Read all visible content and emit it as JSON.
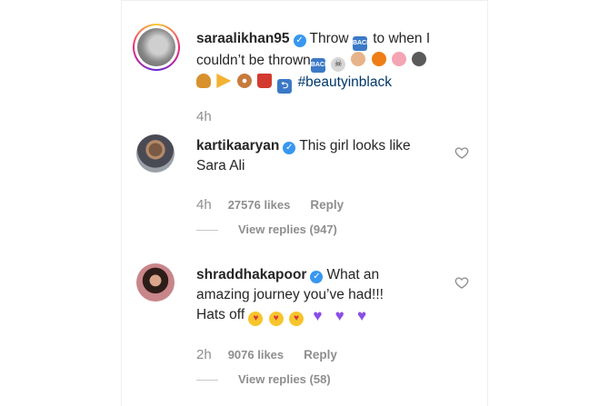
{
  "caption": {
    "username": "saraalikhan95",
    "text_line1_a": "Throw",
    "text_line1_b": "to when I",
    "text_line2": "couldn’t be thrown",
    "hashtag": "#beautyinblack",
    "time": "4h",
    "emoji_icons": [
      "back-arrow",
      "skull-crossbones",
      "raised-hands",
      "jack-o-lantern",
      "pig-face",
      "gorilla",
      "hamburger",
      "pizza",
      "doughnut",
      "cup-with-straw",
      "return-arrow"
    ]
  },
  "comments": [
    {
      "username": "kartikaaryan",
      "text": "This girl looks like Sara Ali",
      "time": "4h",
      "likes": "27576 likes",
      "reply_label": "Reply",
      "view_replies": "View replies (947)"
    },
    {
      "username": "shraddhakapoor",
      "text_line1": "What an",
      "text_line2": "amazing journey you’ve had!!!",
      "text_line3": "Hats off",
      "time": "2h",
      "likes": "9076 likes",
      "reply_label": "Reply",
      "view_replies": "View replies (58)",
      "emoji_icons": [
        "face-blowing-kiss",
        "face-blowing-kiss",
        "face-blowing-kiss",
        "purple-heart",
        "purple-heart",
        "purple-heart"
      ]
    }
  ],
  "colors": {
    "verified": "#3897f0",
    "hashtag": "#00376b",
    "secondary_text": "#8e8e8e",
    "primary_text": "#262626"
  }
}
